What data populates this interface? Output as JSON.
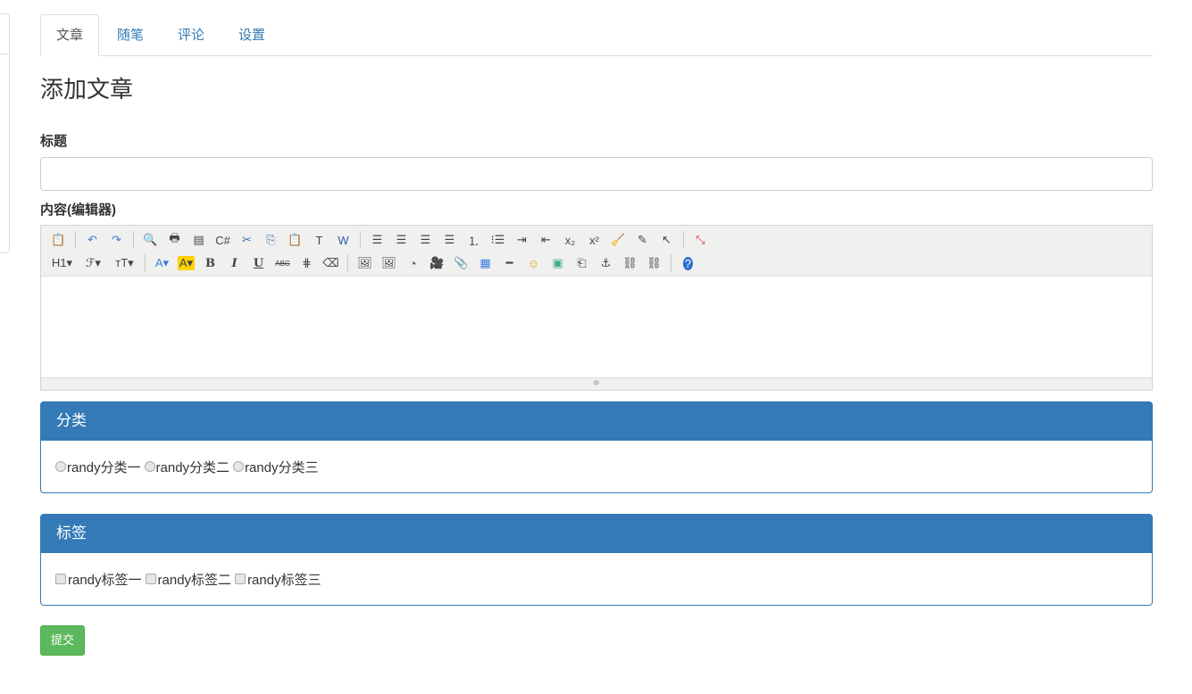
{
  "tabs": [
    {
      "label": "文章"
    },
    {
      "label": "随笔"
    },
    {
      "label": "评论"
    },
    {
      "label": "设置"
    }
  ],
  "page_title": "添加文章",
  "form": {
    "title_label": "标题",
    "title_value": "",
    "content_label": "内容(编辑器)",
    "toolbar_row1": [
      {
        "name": "source-icon",
        "g": "📋"
      },
      "|",
      {
        "name": "undo-icon",
        "g": "↶",
        "c": "#3b7ddd"
      },
      {
        "name": "redo-icon",
        "g": "↷",
        "c": "#3b7ddd"
      },
      "|",
      {
        "name": "preview-icon",
        "g": "🔍"
      },
      {
        "name": "print-icon",
        "g": "🖶"
      },
      {
        "name": "template-icon",
        "g": "▤"
      },
      {
        "name": "code-icon",
        "g": "C#"
      },
      {
        "name": "cut-icon",
        "g": "✂",
        "c": "#3b6fb6"
      },
      {
        "name": "copy-icon",
        "g": "⎘",
        "c": "#3b6fb6"
      },
      {
        "name": "paste-icon",
        "g": "📋"
      },
      {
        "name": "paste-text-icon",
        "g": "T"
      },
      {
        "name": "paste-word-icon",
        "g": "W",
        "c": "#2a5caa"
      },
      "|",
      {
        "name": "align-left-icon",
        "g": "☰"
      },
      {
        "name": "align-center-icon",
        "g": "☰"
      },
      {
        "name": "align-right-icon",
        "g": "☰"
      },
      {
        "name": "justify-icon",
        "g": "☰"
      },
      {
        "name": "ordered-list-icon",
        "g": "⒈"
      },
      {
        "name": "unordered-list-icon",
        "g": "⁝☰"
      },
      {
        "name": "indent-icon",
        "g": "⇥"
      },
      {
        "name": "outdent-icon",
        "g": "⇤"
      },
      {
        "name": "subscript-icon",
        "g": "x₂"
      },
      {
        "name": "superscript-icon",
        "g": "x²"
      },
      {
        "name": "clear-format-icon",
        "g": "🧹"
      },
      {
        "name": "select-all-icon",
        "g": "✎"
      },
      {
        "name": "pointer-icon",
        "g": "↖"
      },
      "|",
      {
        "name": "fullscreen-icon",
        "g": "⤡",
        "c": "#d33"
      }
    ],
    "toolbar_row2": [
      {
        "name": "heading-icon",
        "g": "H1▾",
        "w": 1
      },
      {
        "name": "font-family-icon",
        "g": "ℱ▾",
        "w": 1
      },
      {
        "name": "font-size-icon",
        "g": "ᴛT▾",
        "w": 1
      },
      "|",
      {
        "name": "font-color-icon",
        "g": "A▾",
        "c": "#3b7ddd"
      },
      {
        "name": "highlight-color-icon",
        "g": "A▾",
        "bg": "#ffd200"
      },
      {
        "name": "bold-icon",
        "g": "B"
      },
      {
        "name": "italic-icon",
        "g": "I"
      },
      {
        "name": "underline-icon",
        "g": "U"
      },
      {
        "name": "strikethrough-icon",
        "g": "ABC"
      },
      {
        "name": "line-height-icon",
        "g": "⋕"
      },
      {
        "name": "eraser-icon",
        "g": "⌫"
      },
      "|",
      {
        "name": "insert-image-icon",
        "g": "🖼"
      },
      {
        "name": "insert-multi-image-icon",
        "g": "🖼"
      },
      {
        "name": "flash-icon",
        "g": "◔"
      },
      {
        "name": "media-icon",
        "g": "🎥"
      },
      {
        "name": "attachment-icon",
        "g": "📎"
      },
      {
        "name": "table-icon",
        "g": "▦",
        "c": "#3b7ddd"
      },
      {
        "name": "horizontal-rule-icon",
        "g": "━"
      },
      {
        "name": "emoticon-icon",
        "g": "☺",
        "c": "#e0a800"
      },
      {
        "name": "image-manager-icon",
        "g": "▣",
        "c": "#4a8"
      },
      {
        "name": "page-break-icon",
        "g": "⎗"
      },
      {
        "name": "anchor-icon",
        "g": "⚓"
      },
      {
        "name": "link-icon",
        "g": "⛓"
      },
      {
        "name": "unlink-icon",
        "g": "⛓"
      },
      "|",
      {
        "name": "help-icon",
        "g": "?",
        "c": "#fff",
        "bg": "#2a6ed0",
        "round": 1
      }
    ]
  },
  "category_panel": {
    "title": "分类",
    "options": [
      "randy分类一",
      "randy分类二",
      "randy分类三"
    ]
  },
  "tag_panel": {
    "title": "标签",
    "options": [
      "randy标签一",
      "randy标签二",
      "randy标签三"
    ]
  },
  "submit_label": "提交",
  "colors": {
    "primary": "#337ab7",
    "success": "#5cb85c"
  }
}
